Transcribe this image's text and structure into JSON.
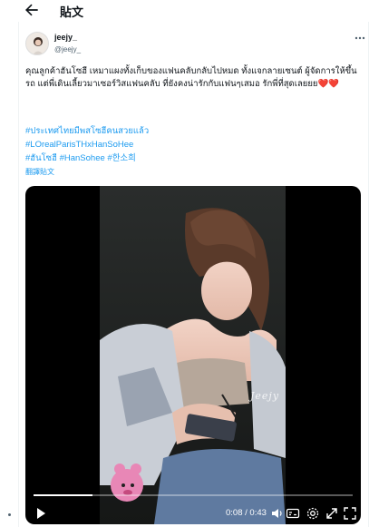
{
  "header": {
    "title": "貼文",
    "back_icon": "arrow-left-icon"
  },
  "author": {
    "display_name": "jeejy_",
    "handle": "@jeejy_"
  },
  "tweet": {
    "text": "คุณลูกค้าฮันโซฮี เหมาแผงทั้งเก็บของแฟนคลับกลับไปหมด ทั้งแจกลายเซนต์ ผู้จัดการให้ขึ้นรถ แต่พี่เดินเลี้ยวมาเซอร์วิสแฟนคลับ ที่ยังคงน่ารักกับแฟนๆเสมอ รักพี่ที่สุดเลยยย",
    "emoji": "❤️❤️",
    "hashtags": [
      "#ประเทศไทยมีพสโซฮีคนสวยแล้ว",
      "#LOrealParisTHxHanSoHee",
      "#ฮันโซฮี",
      "#HanSohee",
      "#한소희"
    ],
    "translate_label": "翻譯貼文"
  },
  "video": {
    "watermark": "Jeejy",
    "time_display": "0:08 / 0:43",
    "progress_fraction": 0.186,
    "controls": [
      "play-icon",
      "captions-icon",
      "settings-icon",
      "expand-icon",
      "fullscreen-icon",
      "volume-icon"
    ]
  },
  "colors": {
    "link": "#1d9bf0",
    "text": "#0f1419",
    "secondary": "#536471",
    "heart": "#e0245e"
  }
}
